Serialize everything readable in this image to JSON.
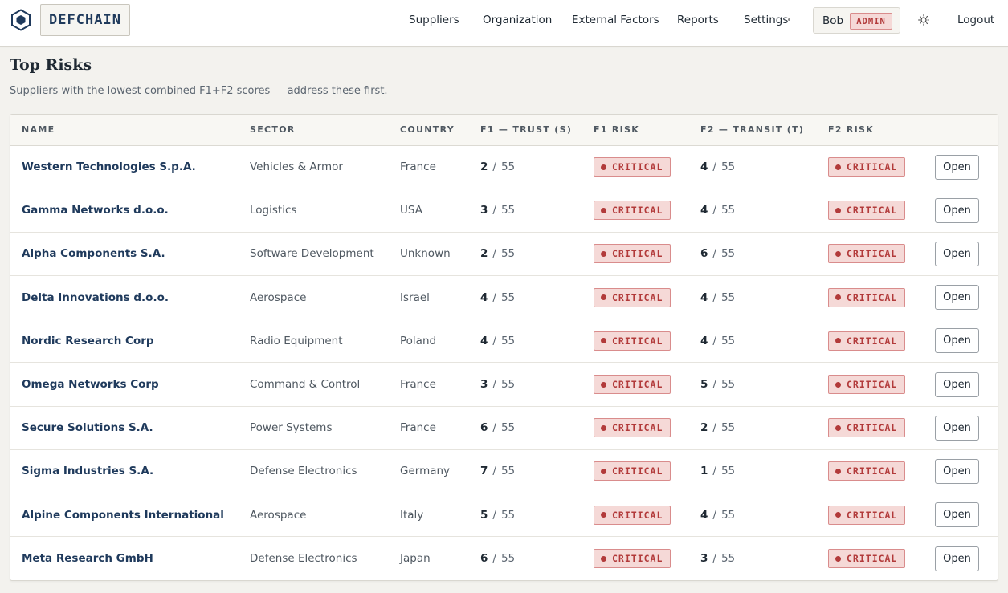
{
  "header": {
    "brand": "DEFCHAIN",
    "logo_icon": "hexagon-logo-icon",
    "nav": {
      "suppliers": "Suppliers",
      "organization": "Organization",
      "external_factors": "External Factors",
      "reports": "Reports",
      "settings": "Settings"
    },
    "user": {
      "name": "Bob",
      "role": "ADMIN"
    },
    "theme_icon": "sun-icon",
    "logout": "Logout"
  },
  "page": {
    "title": "Top Risks",
    "subtitle": "Suppliers with the lowest combined F1+F2 scores — address these first."
  },
  "table": {
    "columns": [
      "NAME",
      "SECTOR",
      "COUNTRY",
      "F1 — TRUST (S)",
      "F1 RISK",
      "F2 — TRANSIT (T)",
      "F2 RISK"
    ],
    "score_separator": "/",
    "open_label": "Open",
    "risk_color": "#b23a3a",
    "rows": [
      {
        "name": "Western Technologies S.p.A.",
        "sector": "Vehicles & Armor",
        "country": "France",
        "f1": "2",
        "f1_max": "55",
        "f1_risk": "CRITICAL",
        "f2": "4",
        "f2_max": "55",
        "f2_risk": "CRITICAL"
      },
      {
        "name": "Gamma Networks d.o.o.",
        "sector": "Logistics",
        "country": "USA",
        "f1": "3",
        "f1_max": "55",
        "f1_risk": "CRITICAL",
        "f2": "4",
        "f2_max": "55",
        "f2_risk": "CRITICAL"
      },
      {
        "name": "Alpha Components S.A.",
        "sector": "Software Development",
        "country": "Unknown",
        "f1": "2",
        "f1_max": "55",
        "f1_risk": "CRITICAL",
        "f2": "6",
        "f2_max": "55",
        "f2_risk": "CRITICAL"
      },
      {
        "name": "Delta Innovations d.o.o.",
        "sector": "Aerospace",
        "country": "Israel",
        "f1": "4",
        "f1_max": "55",
        "f1_risk": "CRITICAL",
        "f2": "4",
        "f2_max": "55",
        "f2_risk": "CRITICAL"
      },
      {
        "name": "Nordic Research Corp",
        "sector": "Radio Equipment",
        "country": "Poland",
        "f1": "4",
        "f1_max": "55",
        "f1_risk": "CRITICAL",
        "f2": "4",
        "f2_max": "55",
        "f2_risk": "CRITICAL"
      },
      {
        "name": "Omega Networks Corp",
        "sector": "Command & Control",
        "country": "France",
        "f1": "3",
        "f1_max": "55",
        "f1_risk": "CRITICAL",
        "f2": "5",
        "f2_max": "55",
        "f2_risk": "CRITICAL"
      },
      {
        "name": "Secure Solutions S.A.",
        "sector": "Power Systems",
        "country": "France",
        "f1": "6",
        "f1_max": "55",
        "f1_risk": "CRITICAL",
        "f2": "2",
        "f2_max": "55",
        "f2_risk": "CRITICAL"
      },
      {
        "name": "Sigma Industries S.A.",
        "sector": "Defense Electronics",
        "country": "Germany",
        "f1": "7",
        "f1_max": "55",
        "f1_risk": "CRITICAL",
        "f2": "1",
        "f2_max": "55",
        "f2_risk": "CRITICAL"
      },
      {
        "name": "Alpine Components International",
        "sector": "Aerospace",
        "country": "Italy",
        "f1": "5",
        "f1_max": "55",
        "f1_risk": "CRITICAL",
        "f2": "4",
        "f2_max": "55",
        "f2_risk": "CRITICAL"
      },
      {
        "name": "Meta Research GmbH",
        "sector": "Defense Electronics",
        "country": "Japan",
        "f1": "6",
        "f1_max": "55",
        "f1_risk": "CRITICAL",
        "f2": "3",
        "f2_max": "55",
        "f2_risk": "CRITICAL"
      }
    ]
  }
}
